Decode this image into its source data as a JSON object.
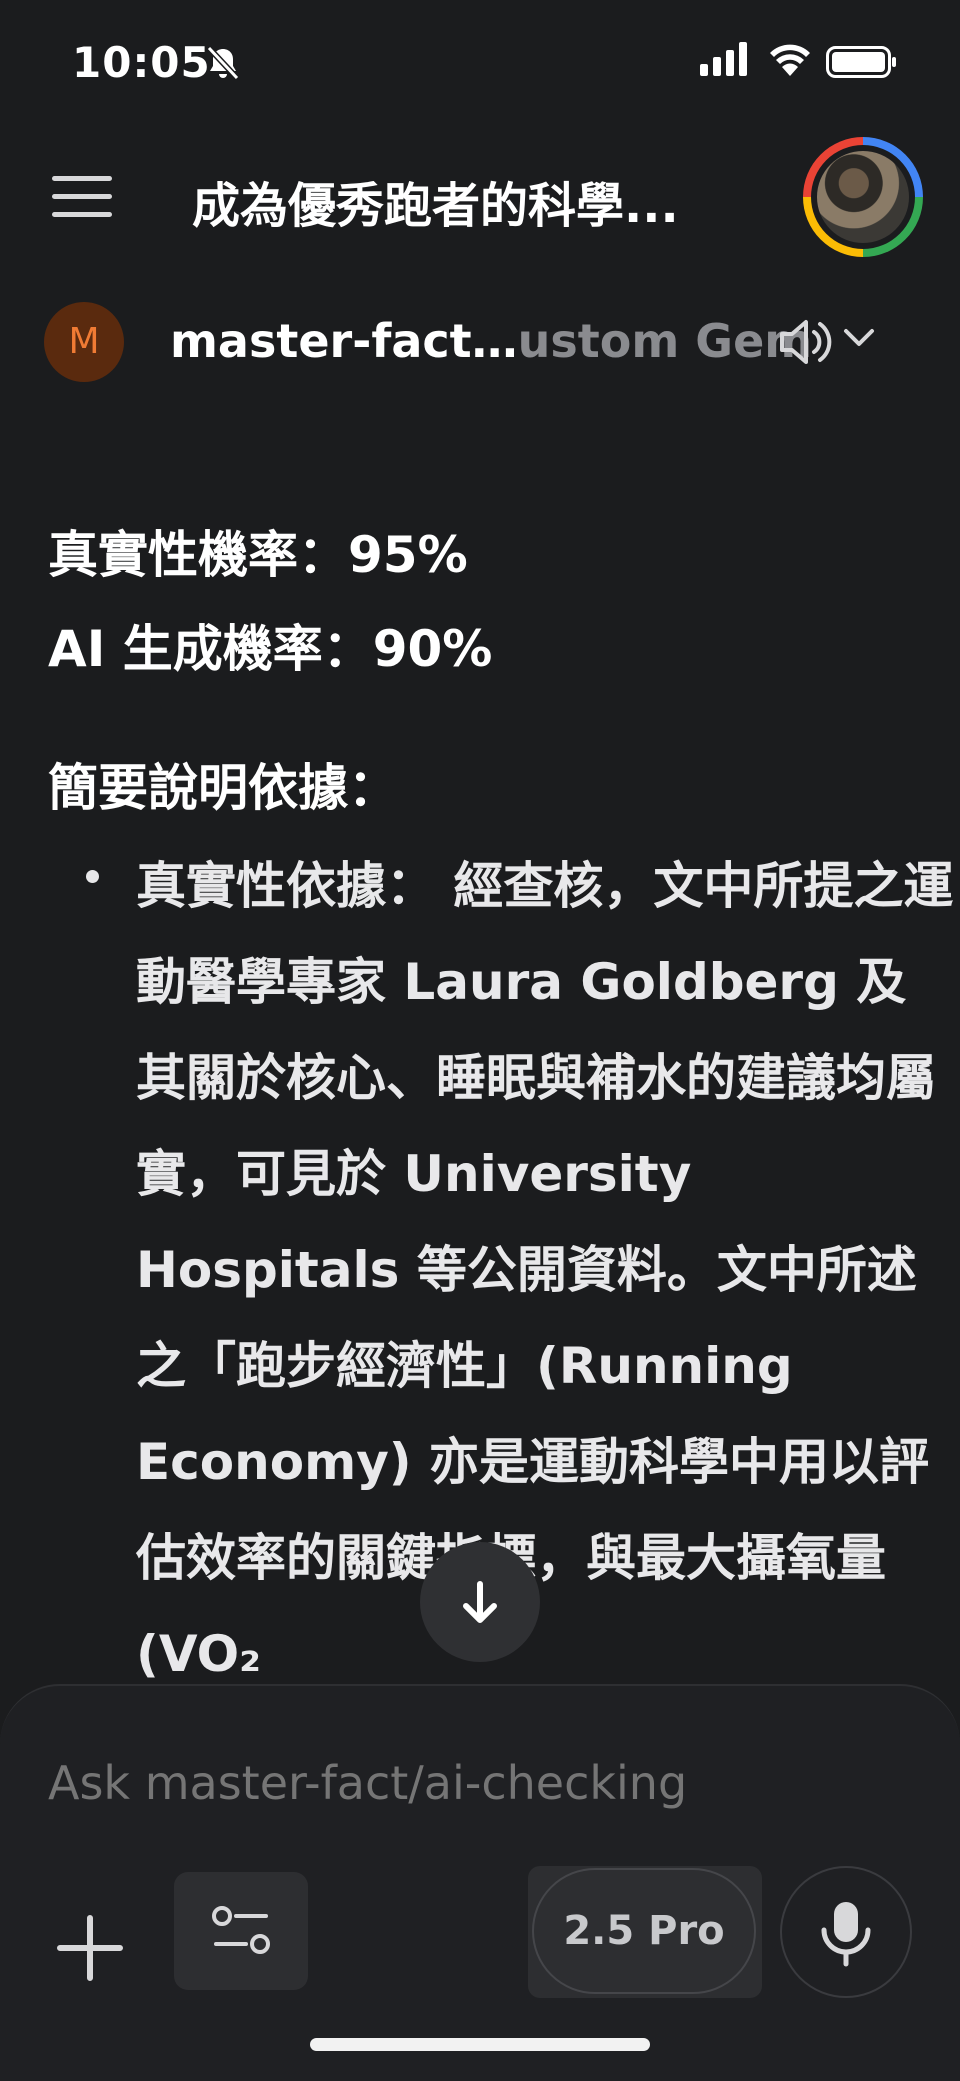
{
  "status_bar": {
    "time": "10:05",
    "icons": [
      "bell-slash-icon",
      "cellular-signal-icon",
      "wifi-icon",
      "battery-icon"
    ]
  },
  "header": {
    "menu_icon": "hamburger-menu-icon",
    "title": "成為優秀跑者的科學...",
    "avatar": "user-avatar"
  },
  "gem": {
    "badge_letter": "M",
    "name_visible": "master-fact…",
    "name_suffix": "ustom Gem",
    "icons": [
      "speaker-icon",
      "chevron-down-icon"
    ],
    "badge_color": "#5a2a0e",
    "badge_text_color": "#f07b34"
  },
  "response": {
    "authenticity_line": "真實性機率：95%",
    "ai_line": "AI 生成機率：90%",
    "summary_heading": "簡要說明依據：",
    "bullets": [
      {
        "label": "真實性依據：",
        "text": " 經查核，文中所提之運動醫學專家 Laura Goldberg 及其關於核心、睡眠與補水的建議均屬實，可見於 University Hospitals 等公開資料。文中所述之「跑步經濟性」(Running Economy) 亦是運動科學中用以評估效率的關鍵指標，與最大攝氧量 (VO₂"
      }
    ]
  },
  "scroll_down_icon": "arrow-down-icon",
  "composer": {
    "placeholder": "Ask master-fact/ai-checking",
    "model_label": "2.5 Pro",
    "icons": [
      "plus-icon",
      "tools-sliders-icon",
      "microphone-icon"
    ]
  },
  "colors": {
    "background": "#1b1c1e",
    "composer_bg": "#1f2023",
    "text_primary": "#ffffff",
    "text_muted": "#8e8f93"
  }
}
